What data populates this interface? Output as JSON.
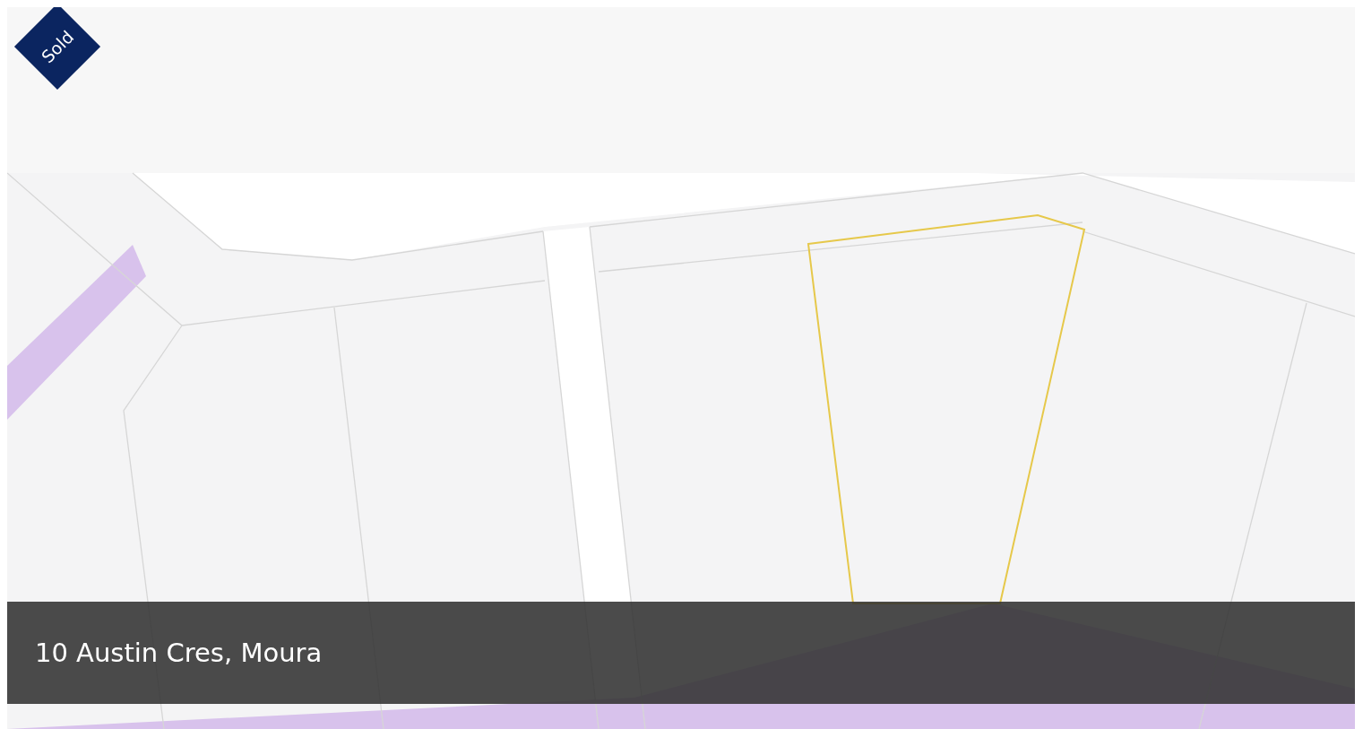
{
  "listing": {
    "status_badge": "Sold",
    "address": "10 Austin Cres, Moura"
  }
}
